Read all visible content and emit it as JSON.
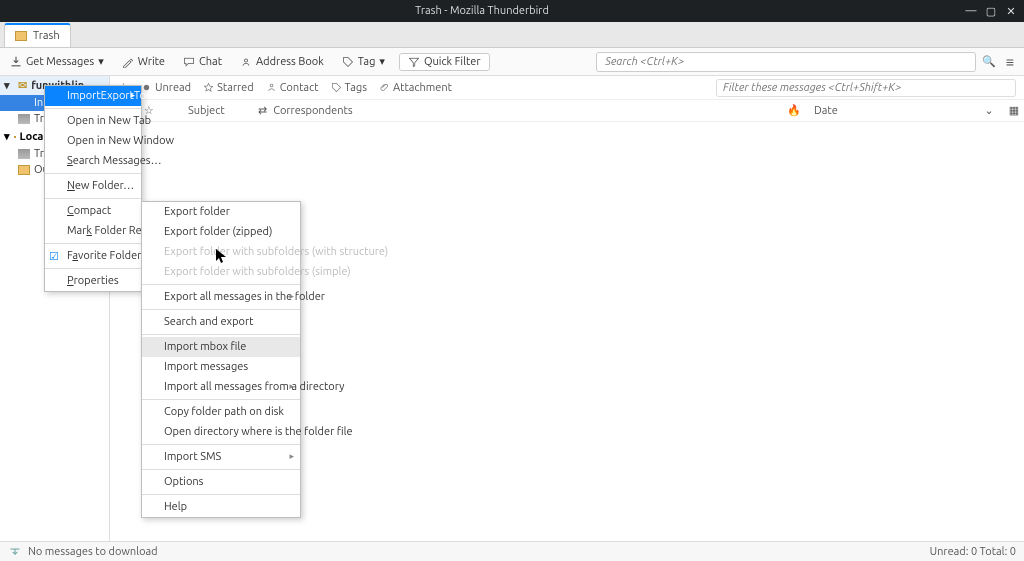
{
  "title": "Trash - Mozilla Thunderbird",
  "tab_label": "Trash",
  "toolbar": {
    "get_messages": "Get Messages",
    "write": "Write",
    "chat": "Chat",
    "address_book": "Address Book",
    "tag": "Tag",
    "quick_filter": "Quick Filter",
    "search_placeholder": "Search <Ctrl+K>"
  },
  "account": "funwithlinux@mail.com",
  "folders": {
    "inbox": "Inbox",
    "trash": "Trash",
    "local": "Local Folders",
    "local_trash": "Trash",
    "outbox": "Outbox"
  },
  "filter": {
    "unread": "Unread",
    "starred": "Starred",
    "contact": "Contact",
    "tags": "Tags",
    "attachment": "Attachment",
    "msg_placeholder": "Filter these messages <Ctrl+Shift+K>"
  },
  "columns": {
    "subject": "Subject",
    "correspondents": "Correspondents",
    "date": "Date"
  },
  "context_menu": {
    "import_export": "ImportExportTools NG",
    "open_new_tab": "Open in New Tab",
    "open_new_window": "Open in New Window",
    "search_messages": "Search Messages…",
    "new_folder": "New Folder…",
    "compact": "Compact",
    "mark_read": "Mark Folder Read",
    "favorite": "Favorite Folder",
    "properties": "Properties"
  },
  "submenu": {
    "export_folder": "Export folder",
    "export_zipped": "Export folder (zipped)",
    "export_sub_struct": "Export folder with subfolders (with structure)",
    "export_sub_simple": "Export folder with subfolders (simple)",
    "export_all": "Export all messages in the folder",
    "search_export": "Search and export",
    "import_mbox": "Import mbox file",
    "import_messages": "Import messages",
    "import_dir": "Import all messages from a directory",
    "copy_path": "Copy folder path on disk",
    "open_dir": "Open directory where is the folder file",
    "import_sms": "Import SMS",
    "options": "Options",
    "help": "Help"
  },
  "status": {
    "no_download": "No messages to download",
    "counts": "Unread: 0   Total: 0"
  }
}
